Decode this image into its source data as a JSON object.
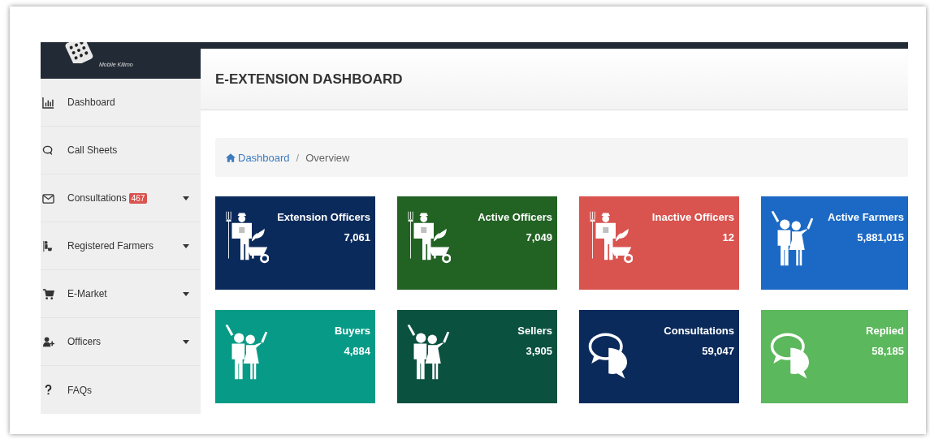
{
  "logo": {
    "subtitle": "Mobile Kilimo"
  },
  "sidebar": {
    "items": [
      {
        "label": "Dashboard",
        "dropdown": false
      },
      {
        "label": "Call Sheets",
        "dropdown": false
      },
      {
        "label": "Consultations",
        "badge": "467",
        "dropdown": true
      },
      {
        "label": "Registered Farmers",
        "dropdown": true
      },
      {
        "label": "E-Market",
        "dropdown": true
      },
      {
        "label": "Officers",
        "dropdown": true
      },
      {
        "label": "FAQs",
        "dropdown": false
      }
    ]
  },
  "header": {
    "title": "E-EXTENSION DASHBOARD"
  },
  "breadcrumb": {
    "items": [
      "Dashboard",
      "Overview"
    ],
    "separator": "/"
  },
  "cards": [
    {
      "kind": "officer",
      "title": "Extension Officers",
      "value": "7,061",
      "color": "#0b2a5c"
    },
    {
      "kind": "officer",
      "title": "Active Officers",
      "value": "7,049",
      "color": "#226223"
    },
    {
      "kind": "officer",
      "title": "Inactive Officers",
      "value": "12",
      "color": "#d9534f"
    },
    {
      "kind": "people",
      "title": "Active Farmers",
      "value": "5,881,015",
      "color": "#1b69c5"
    },
    {
      "kind": "people",
      "title": "Buyers",
      "value": "4,884",
      "color": "#079b87"
    },
    {
      "kind": "people",
      "title": "Sellers",
      "value": "3,905",
      "color": "#0a5140"
    },
    {
      "kind": "chat",
      "title": "Consultations",
      "value": "59,047",
      "color": "#0b2a5c"
    },
    {
      "kind": "chat",
      "title": "Replied",
      "value": "58,185",
      "color": "#5cb85c"
    }
  ]
}
